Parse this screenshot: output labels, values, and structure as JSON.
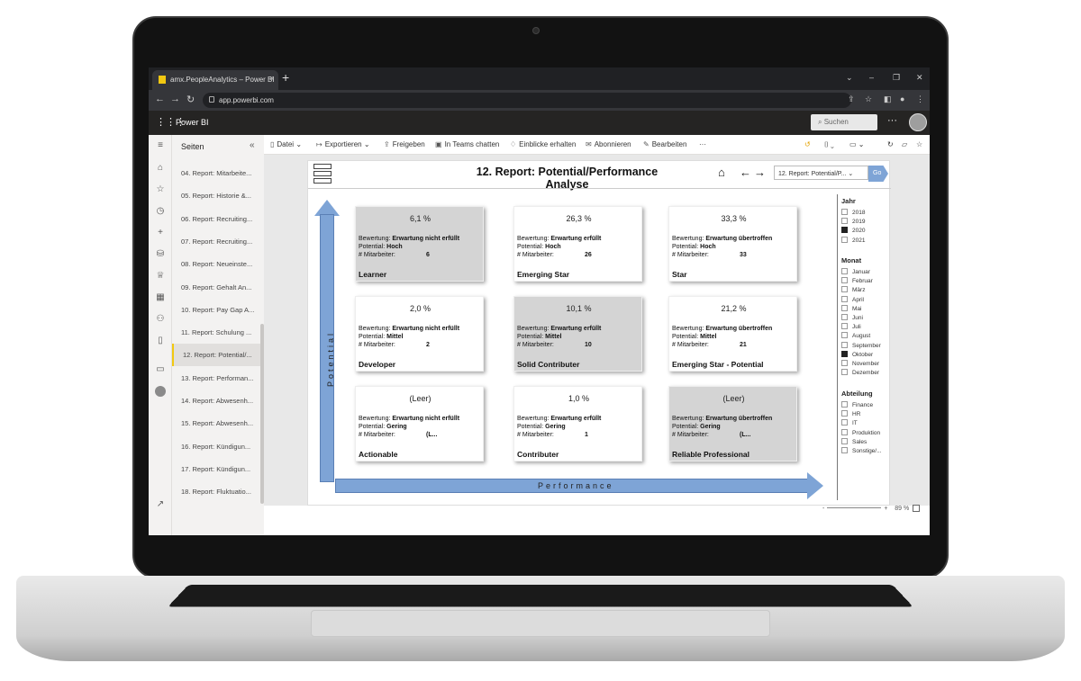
{
  "browser": {
    "tab_title": "amx.PeopleAnalytics – Power BI",
    "tab_close": "×",
    "new_tab": "+",
    "url": "app.powerbi.com",
    "window_controls": [
      "⌄",
      "–",
      "❐",
      "✕"
    ],
    "nav_icons": [
      "back-icon",
      "forward-icon",
      "reload-icon"
    ]
  },
  "pbi": {
    "app_name": "Power BI",
    "search_placeholder": "Suchen",
    "more": "···"
  },
  "pages_pane": {
    "title": "Seiten",
    "items": [
      {
        "label": "04. Report: Mitarbeite..."
      },
      {
        "label": "05. Report: Historie &..."
      },
      {
        "label": "06. Report: Recruiting..."
      },
      {
        "label": "07. Report: Recruiting..."
      },
      {
        "label": "08. Report: Neueinste..."
      },
      {
        "label": "09. Report: Gehalt An..."
      },
      {
        "label": "10. Report: Pay Gap A..."
      },
      {
        "label": "11. Report: Schulung ..."
      },
      {
        "label": "12. Report: Potential/..."
      },
      {
        "label": "13. Report: Performan..."
      },
      {
        "label": "14. Report: Abwesenh..."
      },
      {
        "label": "15. Report: Abwesenh..."
      },
      {
        "label": "16. Report: Kündigun..."
      },
      {
        "label": "17. Report: Kündigun..."
      },
      {
        "label": "18. Report: Fluktuatio..."
      }
    ],
    "active_index": 8
  },
  "toolbar": {
    "datei": "Datei",
    "exportieren": "Exportieren",
    "freigeben": "Freigeben",
    "teams": "In Teams chatten",
    "einblicke": "Einblicke erhalten",
    "abonnieren": "Abonnieren",
    "bearbeiten": "Bearbeiten",
    "more": "···"
  },
  "report": {
    "title": "12. Report: Potential/Performance Analyse",
    "page_dropdown": "12. Report: Potential/P...",
    "go": "Go",
    "axis_y": "Potential",
    "axis_x": "Performance",
    "cards": [
      {
        "pct": "6,1 %",
        "bewertung": "Erwartung nicht erfüllt",
        "potential": "Hoch",
        "mitarbeiter": "6",
        "name": "Learner",
        "grey": true
      },
      {
        "pct": "26,3 %",
        "bewertung": "Erwartung erfüllt",
        "potential": "Hoch",
        "mitarbeiter": "26",
        "name": "Emerging Star",
        "grey": false
      },
      {
        "pct": "33,3 %",
        "bewertung": "Erwartung übertroffen",
        "potential": "Hoch",
        "mitarbeiter": "33",
        "name": "Star",
        "grey": false
      },
      {
        "pct": "2,0 %",
        "bewertung": "Erwartung nicht erfüllt",
        "potential": "Mittel",
        "mitarbeiter": "2",
        "name": "Developer",
        "grey": false
      },
      {
        "pct": "10,1 %",
        "bewertung": "Erwartung erfüllt",
        "potential": "Mittel",
        "mitarbeiter": "10",
        "name": "Solid Contributer",
        "grey": true
      },
      {
        "pct": "21,2 %",
        "bewertung": "Erwartung übertroffen",
        "potential": "Mittel",
        "mitarbeiter": "21",
        "name": "Emerging Star - Potential",
        "grey": false
      },
      {
        "pct": "(Leer)",
        "bewertung": "Erwartung nicht erfüllt",
        "potential": "Gering",
        "mitarbeiter": "(L...",
        "name": "Actionable",
        "grey": false
      },
      {
        "pct": "1,0 %",
        "bewertung": "Erwartung erfüllt",
        "potential": "Gering",
        "mitarbeiter": "1",
        "name": "Contributer",
        "grey": false
      },
      {
        "pct": "(Leer)",
        "bewertung": "Erwartung übertroffen",
        "potential": "Gering",
        "mitarbeiter": "(L...",
        "name": "Reliable Professional",
        "grey": true
      }
    ],
    "labels": {
      "bewertung": "Bewertung:",
      "potential": "Potential:",
      "mitarbeiter": "# Mitarbeiter:"
    }
  },
  "filters": {
    "jahr": {
      "title": "Jahr",
      "items": [
        {
          "label": "2018",
          "on": false
        },
        {
          "label": "2019",
          "on": false
        },
        {
          "label": "2020",
          "on": true
        },
        {
          "label": "2021",
          "on": false
        }
      ]
    },
    "monat": {
      "title": "Monat",
      "items": [
        {
          "label": "Januar",
          "on": false
        },
        {
          "label": "Februar",
          "on": false
        },
        {
          "label": "März",
          "on": false
        },
        {
          "label": "April",
          "on": false
        },
        {
          "label": "Mai",
          "on": false
        },
        {
          "label": "Juni",
          "on": false
        },
        {
          "label": "Juli",
          "on": false
        },
        {
          "label": "August",
          "on": false
        },
        {
          "label": "September",
          "on": false
        },
        {
          "label": "Oktober",
          "on": true
        },
        {
          "label": "November",
          "on": false
        },
        {
          "label": "Dezember",
          "on": false
        }
      ]
    },
    "abteilung": {
      "title": "Abteilung",
      "items": [
        {
          "label": "Finance",
          "on": false
        },
        {
          "label": "HR",
          "on": false
        },
        {
          "label": "IT",
          "on": false
        },
        {
          "label": "Produktion",
          "on": false
        },
        {
          "label": "Sales",
          "on": false
        },
        {
          "label": "Sonstige/...",
          "on": false
        }
      ]
    }
  },
  "zoom": {
    "minus": "-",
    "plus": "+",
    "level": "89 %"
  },
  "colors": {
    "accent": "#f2c811",
    "arrow": "#7ea4d6",
    "card_grey": "#d4d4d4"
  }
}
